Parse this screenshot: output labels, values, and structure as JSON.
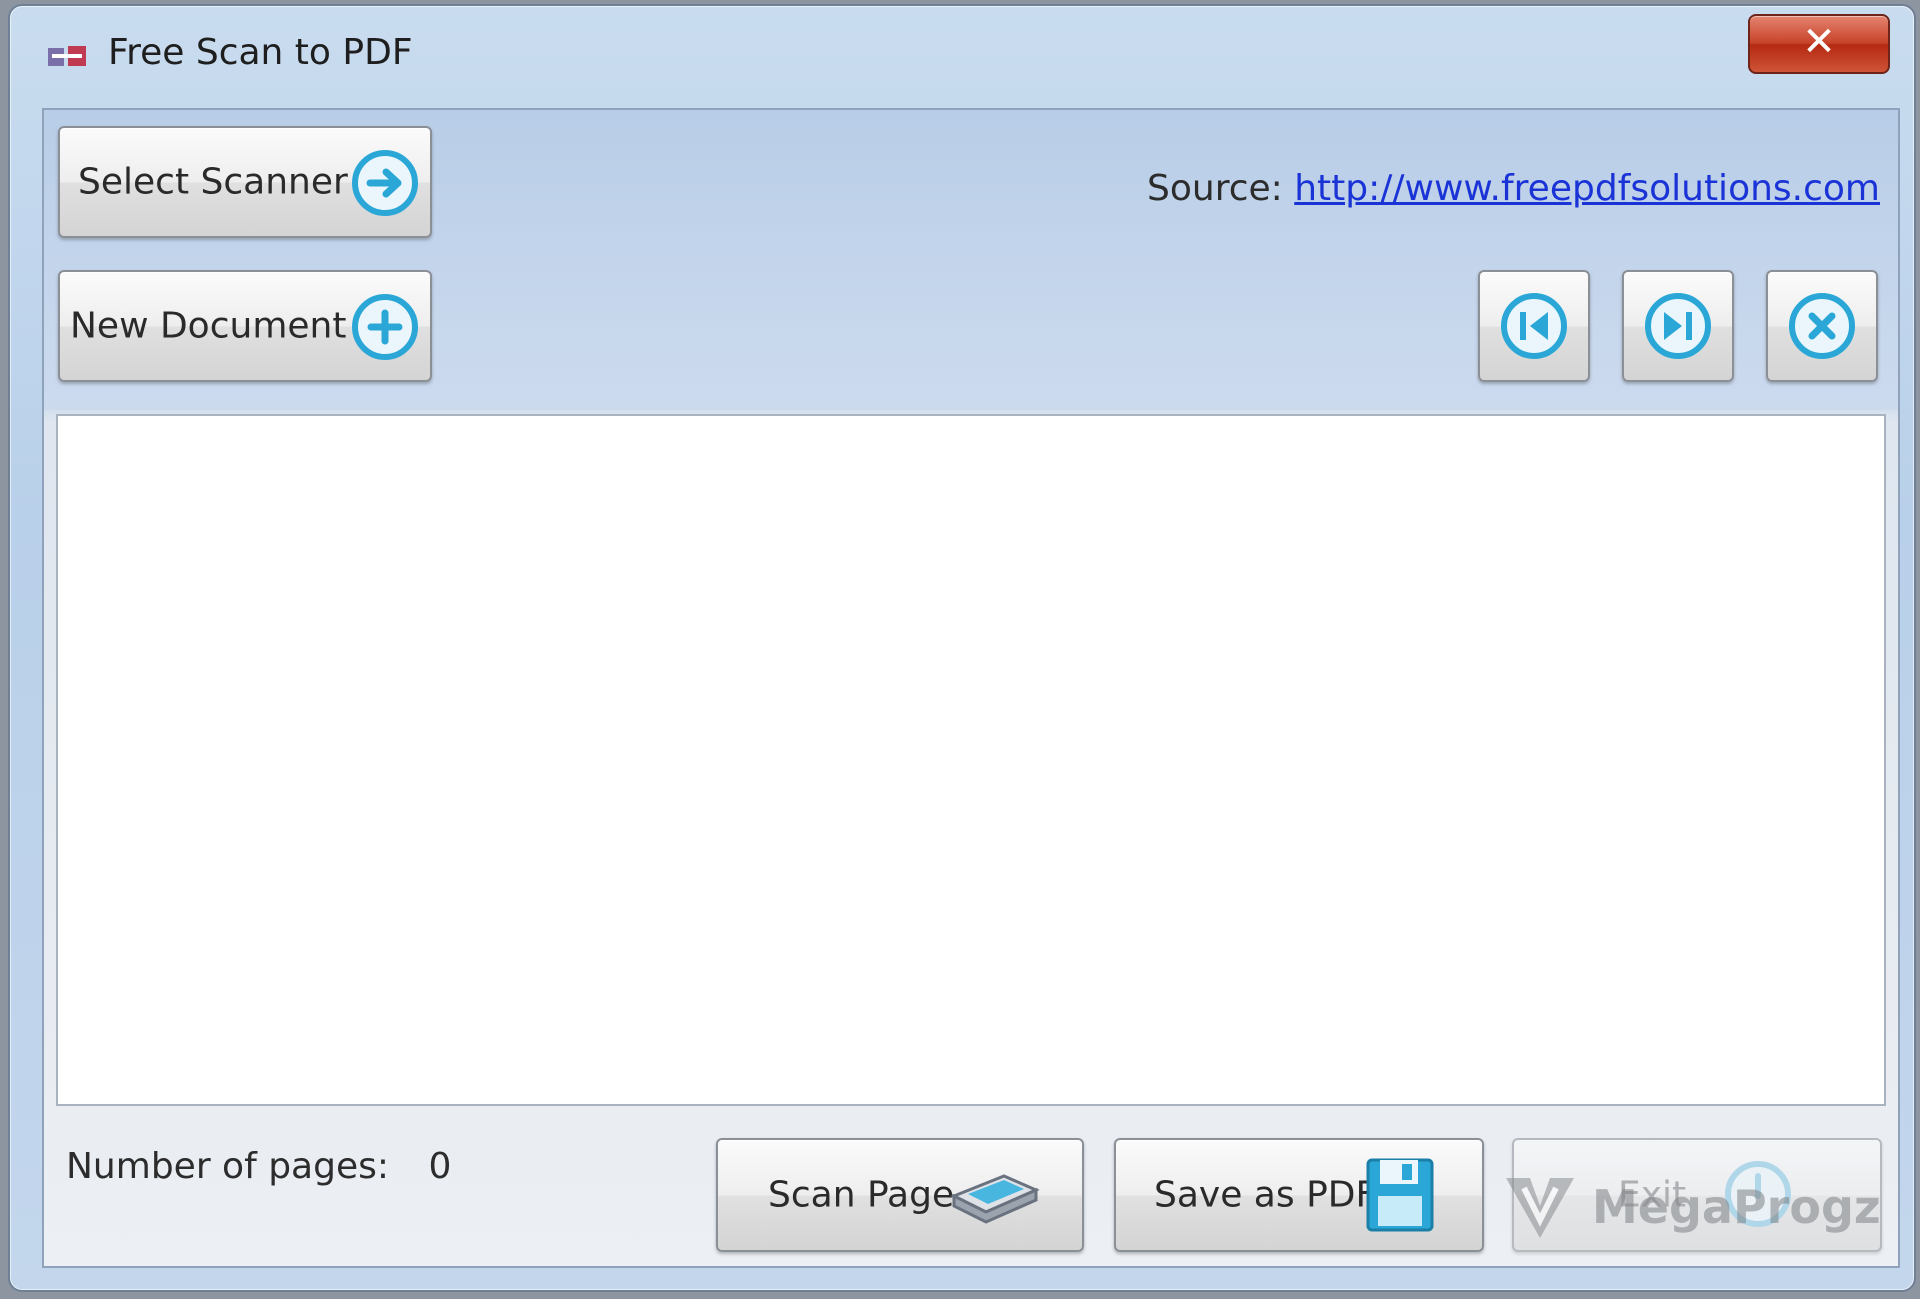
{
  "window": {
    "title": "Free Scan to PDF",
    "close_label": "✕"
  },
  "toolbar": {
    "select_scanner_label": "Select Scanner",
    "new_document_label": "New Document",
    "source_label": "Source:",
    "source_link": "http://www.freepdfsolutions.com",
    "nav_buttons": [
      "first-page",
      "last-page",
      "delete-page"
    ]
  },
  "footer": {
    "pages_label": "Number of pages:",
    "pages_count": "0",
    "scan_page_label": "Scan Page",
    "save_pdf_label": "Save as PDF",
    "exit_label": "Exit"
  },
  "watermark": {
    "text": "MegaProgz"
  },
  "colors": {
    "accent": "#2aa7d6",
    "link": "#1a33d6",
    "close": "#c8432a"
  }
}
